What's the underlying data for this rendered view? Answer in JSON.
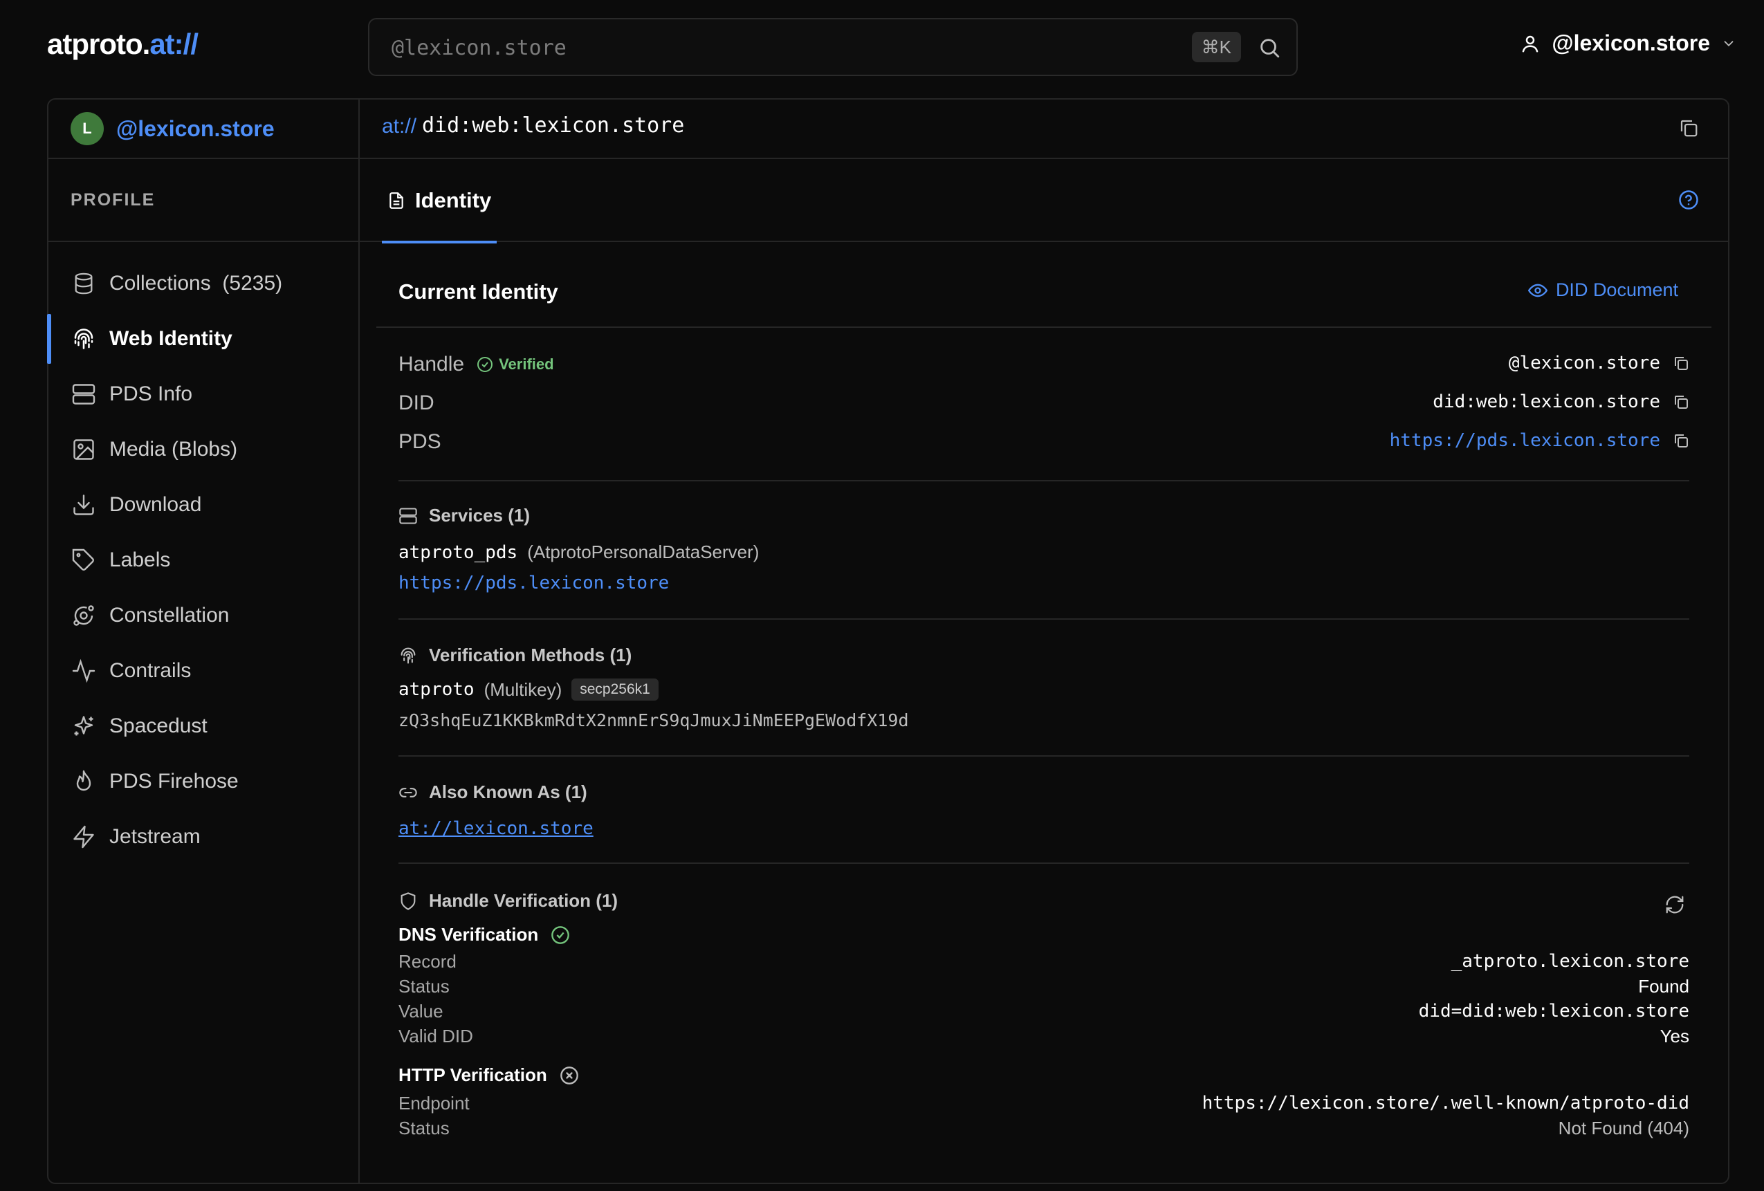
{
  "header": {
    "logo_main": "atproto.",
    "logo_accent": "at://",
    "search_placeholder": "@lexicon.store",
    "search_shortcut": "⌘K",
    "user_handle": "@lexicon.store"
  },
  "sidebar": {
    "avatar_letter": "L",
    "handle": "@lexicon.store",
    "section_label": "PROFILE",
    "items": [
      {
        "label": "Collections  (5235)",
        "icon": "database-icon"
      },
      {
        "label": "Web Identity",
        "icon": "fingerprint-icon",
        "active": true
      },
      {
        "label": "PDS Info",
        "icon": "server-icon"
      },
      {
        "label": "Media (Blobs)",
        "icon": "image-icon"
      },
      {
        "label": "Download",
        "icon": "download-icon"
      },
      {
        "label": "Labels",
        "icon": "tag-icon"
      },
      {
        "label": "Constellation",
        "icon": "orbit-icon"
      },
      {
        "label": "Contrails",
        "icon": "activity-icon"
      },
      {
        "label": "Spacedust",
        "icon": "sparkles-icon"
      },
      {
        "label": "PDS Firehose",
        "icon": "flame-icon"
      },
      {
        "label": "Jetstream",
        "icon": "zap-icon"
      }
    ]
  },
  "path": {
    "prefix": "at://",
    "did": "did:web:lexicon.store"
  },
  "tabs": {
    "active": "Identity"
  },
  "identity": {
    "title": "Current Identity",
    "did_document_label": "DID Document",
    "handle_label": "Handle",
    "verified_label": "Verified",
    "handle_value": "@lexicon.store",
    "did_label": "DID",
    "did_value": "did:web:lexicon.store",
    "pds_label": "PDS",
    "pds_value": "https://pds.lexicon.store"
  },
  "services": {
    "title": "Services (1)",
    "id": "atproto_pds",
    "type": "(AtprotoPersonalDataServer)",
    "endpoint": "https://pds.lexicon.store"
  },
  "verification_methods": {
    "title": "Verification Methods (1)",
    "id": "atproto",
    "type": "(Multikey)",
    "curve": "secp256k1",
    "key": "zQ3shqEuZ1KKBkmRdtX2nmnErS9qJmuxJiNmEEPgEWodfX19d"
  },
  "also_known_as": {
    "title": "Also Known As (1)",
    "value": "at://lexicon.store"
  },
  "handle_verification": {
    "title": "Handle Verification (1)",
    "dns_title": "DNS Verification",
    "dns_rows": [
      {
        "k": "Record",
        "v": "_atproto.lexicon.store",
        "mono": true
      },
      {
        "k": "Status",
        "v": "Found",
        "mono": false
      },
      {
        "k": "Value",
        "v": "did=did:web:lexicon.store",
        "mono": true
      },
      {
        "k": "Valid DID",
        "v": "Yes",
        "mono": false
      }
    ],
    "http_title": "HTTP Verification",
    "http_rows": [
      {
        "k": "Endpoint",
        "v": "https://lexicon.store/.well-known/atproto-did",
        "mono": true
      },
      {
        "k": "Status",
        "v": "Not Found (404)",
        "mono": false
      }
    ]
  },
  "colors": {
    "accent": "#4e8ef7",
    "success": "#74c47c",
    "background": "#0b0b0b",
    "border": "#262626"
  }
}
